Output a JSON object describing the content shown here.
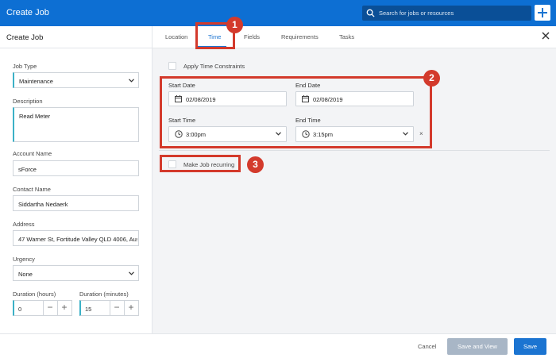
{
  "app": {
    "title": "Create Job"
  },
  "search": {
    "placeholder": "Search for jobs or resources",
    "icon": "search-icon"
  },
  "add_button": {
    "icon": "plus-icon"
  },
  "sidebar": {
    "title": "Create Job",
    "job_type": {
      "label": "Job Type",
      "value": "Maintenance"
    },
    "description": {
      "label": "Description",
      "value": "Read Meter"
    },
    "account_name": {
      "label": "Account Name",
      "value": "sForce"
    },
    "contact_name": {
      "label": "Contact Name",
      "value": "Siddartha Nedaerk"
    },
    "address": {
      "label": "Address",
      "value": "47 Warner St, Fortitude Valley QLD 4006, Aus"
    },
    "urgency": {
      "label": "Urgency",
      "value": "None"
    },
    "duration_hours": {
      "label": "Duration (hours)",
      "value": "0",
      "minus": "−",
      "plus": "+"
    },
    "duration_minutes": {
      "label": "Duration (minutes)",
      "value": "15",
      "minus": "−",
      "plus": "+"
    }
  },
  "tabs": [
    {
      "label": "Location",
      "active": false
    },
    {
      "label": "Time",
      "active": true
    },
    {
      "label": "Fields",
      "active": false
    },
    {
      "label": "Requirements",
      "active": false
    },
    {
      "label": "Tasks",
      "active": false
    }
  ],
  "time": {
    "apply_constraints_label": "Apply Time Constraints",
    "start_date": {
      "label": "Start Date",
      "value": "02/08/2019"
    },
    "end_date": {
      "label": "End Date",
      "value": "02/08/2019"
    },
    "start_time": {
      "label": "Start Time",
      "value": "3:00pm"
    },
    "end_time": {
      "label": "End Time",
      "value": "3:15pm"
    },
    "clear": "×",
    "recurring_label": "Make Job recurring"
  },
  "annotations": [
    "1",
    "2",
    "3"
  ],
  "footer": {
    "cancel": "Cancel",
    "save_and_view": "Save and View",
    "save": "Save"
  },
  "colors": {
    "primary": "#1b74d1",
    "topbar": "#0d6fd3",
    "highlight": "#d33a2c",
    "accent": "#3bb1c7",
    "disabled_button": "#a8b6c6"
  }
}
